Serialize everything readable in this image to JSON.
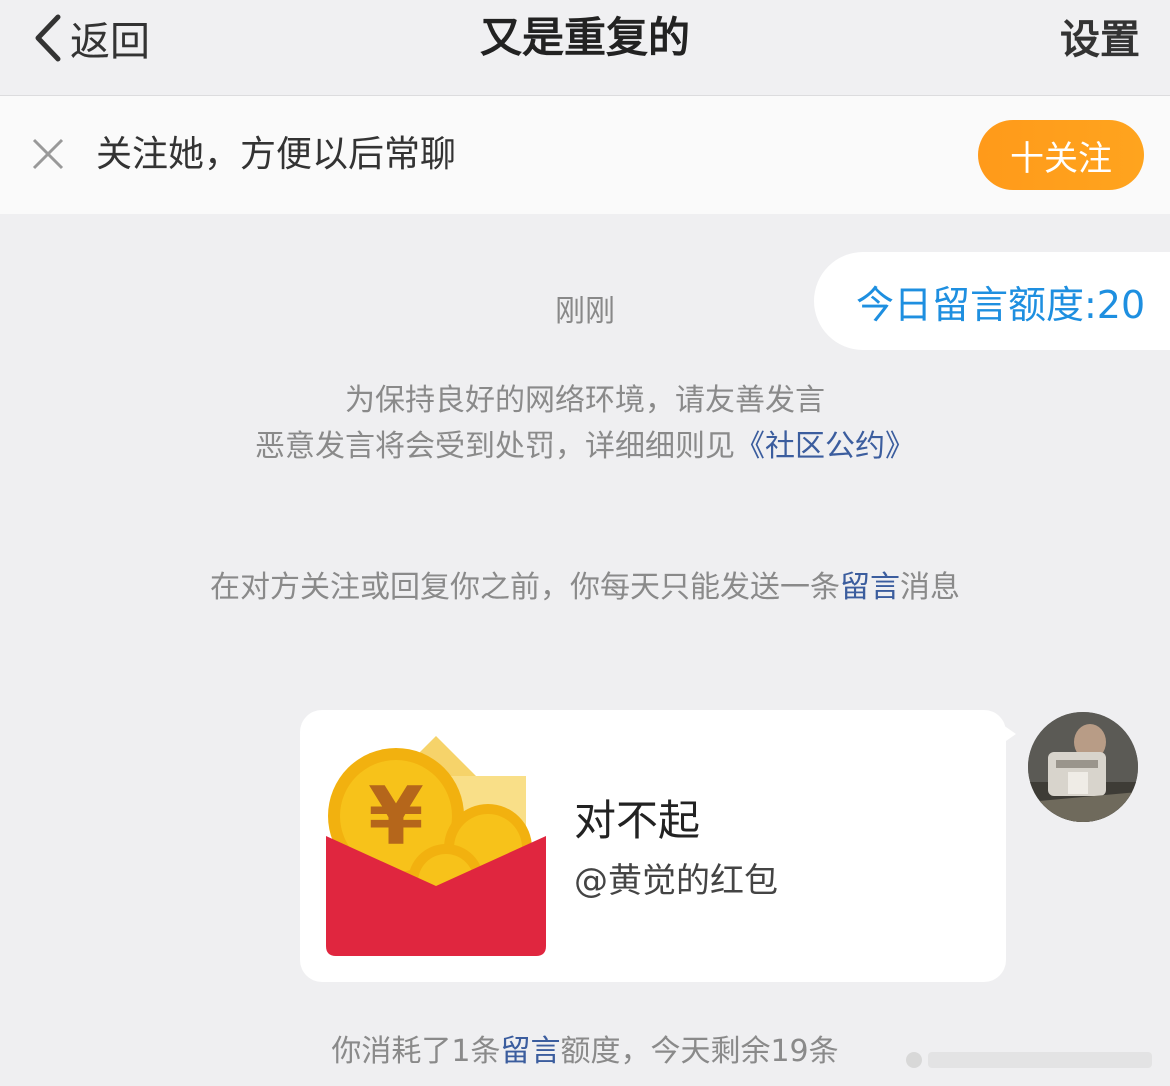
{
  "header": {
    "back_label": "返回",
    "title": "又是重复的",
    "settings_label": "设置"
  },
  "follow_bar": {
    "text": "关注她，方便以后常聊",
    "button_label": "十关注"
  },
  "quota": {
    "label": "今日留言额度:20"
  },
  "chat": {
    "time": "刚刚",
    "notice_line1": "为保持良好的网络环境，请友善发言",
    "notice_line2_prefix": "恶意发言将会受到处罚，详细细则见",
    "notice_line2_link": "《社区公约》",
    "rule_prefix": "在对方关注或回复你之前，你每天只能发送一条",
    "rule_link": "留言",
    "rule_suffix": "消息",
    "message": {
      "title": "对不起",
      "subtitle": "@黄觉的红包"
    },
    "consumed_prefix": "你消耗了1条",
    "consumed_link": "留言",
    "consumed_suffix": "额度，今天剩余19条"
  },
  "colors": {
    "accent_blue": "#1e8fe0",
    "link_blue": "#3b5d9e",
    "follow_orange": "#ff9a1a",
    "envelope_red": "#e0263f",
    "coin_gold": "#f7c21a"
  }
}
